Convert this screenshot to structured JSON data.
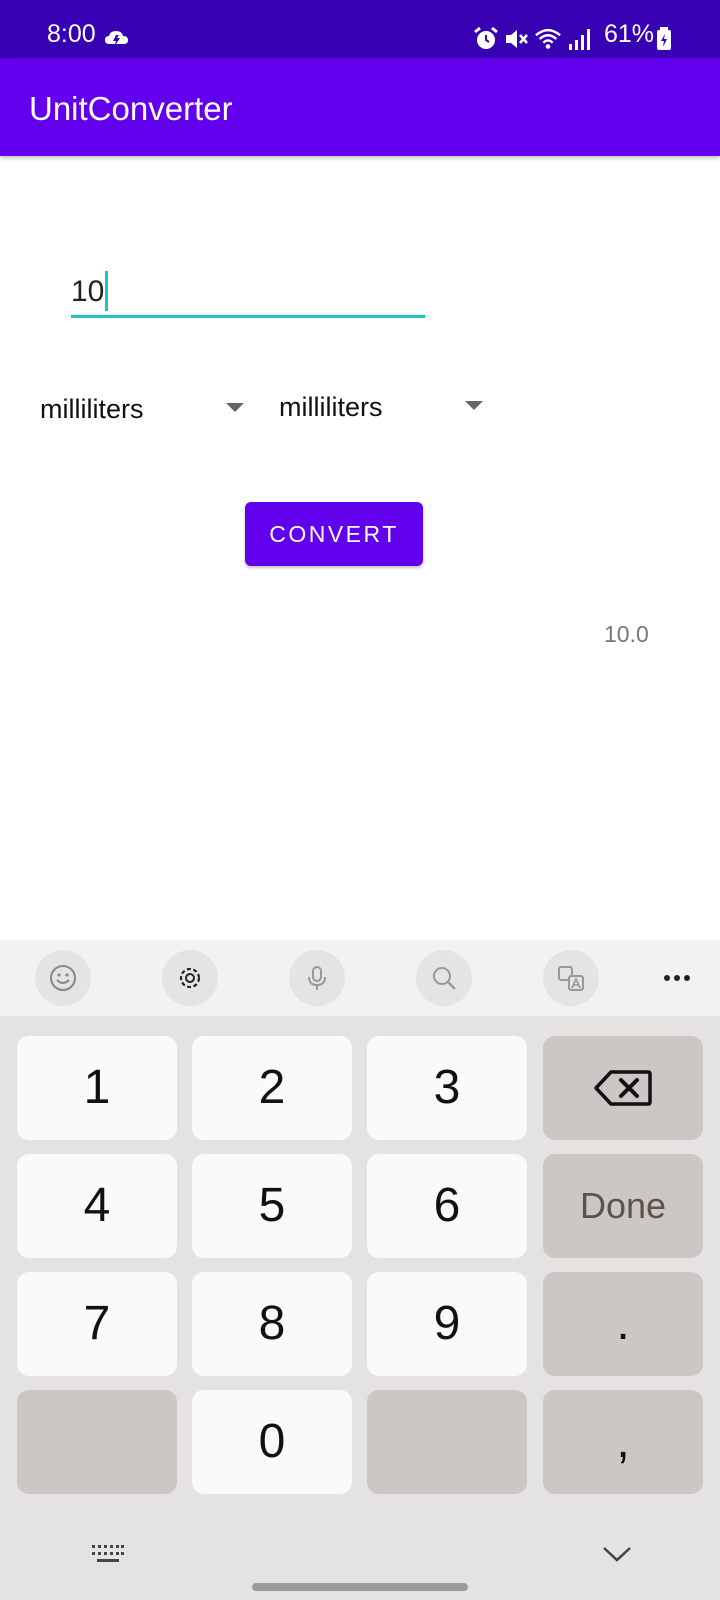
{
  "status_bar": {
    "time": "8:00",
    "battery": "61%",
    "icons": [
      "weather-cloud-icon",
      "alarm-icon",
      "mute-icon",
      "wifi-icon",
      "signal-icon",
      "battery-icon"
    ]
  },
  "app_bar": {
    "title": "UnitConverter"
  },
  "input": {
    "value": "10"
  },
  "from_unit": {
    "selected": "milliliters"
  },
  "to_unit": {
    "selected": "milliliters"
  },
  "convert_button": {
    "label": "CONVERT"
  },
  "result": {
    "value": "10.0"
  },
  "keyboard": {
    "toolbar_icons": [
      "emoji-icon",
      "settings-icon",
      "microphone-icon",
      "search-icon",
      "translate-icon",
      "more-icon"
    ],
    "keys": {
      "k1": "1",
      "k2": "2",
      "k3": "3",
      "k4": "4",
      "k5": "5",
      "k6": "6",
      "k7": "7",
      "k8": "8",
      "k9": "9",
      "k0": "0",
      "done": "Done",
      "period": ".",
      "comma": ","
    }
  },
  "colors": {
    "status_bar": "#3700b3",
    "primary": "#6200ee",
    "accent": "#1fc4c4"
  }
}
